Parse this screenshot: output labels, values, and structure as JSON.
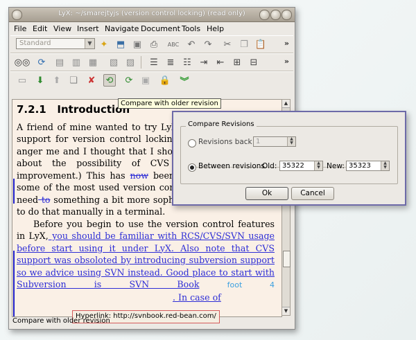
{
  "window": {
    "title": "LyX: ~/smarejtyjs (version control locking) (read only)"
  },
  "menu": [
    "File",
    "Edit",
    "View",
    "Insert",
    "Navigate",
    "Document",
    "Tools",
    "Help"
  ],
  "toolbar1": {
    "style_combo": "Standard",
    "icons": [
      "new-icon",
      "open-icon",
      "save-icon",
      "print-icon",
      "spellcheck-icon",
      "undo-icon",
      "redo-icon",
      "cut-icon",
      "copy-icon",
      "paste-icon"
    ]
  },
  "toolbar2": {
    "icons": [
      "view-icon",
      "refresh-icon",
      "view-dvi-icon",
      "view-ps-icon",
      "view-pdf-icon",
      "update-icon",
      "list-icon",
      "enumerate-icon",
      "indent-more-icon",
      "indent-less-icon",
      "outline-icon"
    ]
  },
  "toolbar3": {
    "icons": [
      "vc-register-icon",
      "vc-checkin-icon",
      "vc-checkout-icon",
      "vc-copy-icon",
      "vc-revert-icon",
      "vc-compare-icon",
      "vc-compare-older-icon",
      "vc-lock-icon",
      "vc-lock2-icon",
      "vc-expand-icon"
    ]
  },
  "tooltip": "Compare with older revision",
  "document": {
    "heading_number": "7.2.1",
    "heading_title": "Introduction",
    "p1_a": "A friend of mine wanted to try LyX. When he didn't find support for version control locking, he dropped it. This anger me and I thought that I should at least make note about the possibility of CVS and/or SVN usage improvement.) This has ",
    "p1_del1": "now",
    "p1_b": " been added, LyX supports some of the most used version control commands. If you need",
    "p1_del2": " to",
    "p1_c": " something a bit more sophisticated you will have to do that manually in a terminal.",
    "p2_a": "Before you begin to use the version control features in LyX,",
    "p2_chg": " you should be familiar with RCS/CVS/SVN usage before start using it under LyX. Also note that CVS support was obsoloted by introducing subversion support so we advice using SVN instead. Good place to start with Subversion is SVN Book",
    "p2_foot": "foot 4",
    "p2_end": ". In case of"
  },
  "hyperlink_tip": "Hyperlink: http://svnbook.red-bean.com/",
  "status": "Compare with older revision",
  "dialog": {
    "group_title": "Compare Revisions",
    "radio1_label": "Revisions back",
    "radio1_value": "1",
    "radio2_label": "Between revisions",
    "old_label": "Old:",
    "old_value": "35322",
    "new_label": "New:",
    "new_value": "35323",
    "ok": "Ok",
    "cancel": "Cancel"
  }
}
